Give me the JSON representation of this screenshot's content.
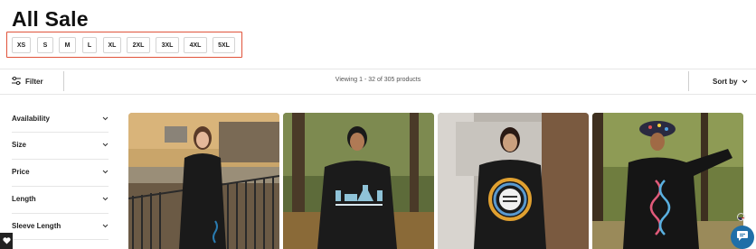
{
  "page": {
    "title": "All Sale"
  },
  "sizes": [
    "XS",
    "S",
    "M",
    "L",
    "XL",
    "2XL",
    "3XL",
    "4XL",
    "5XL"
  ],
  "toolbar": {
    "filter_label": "Filter",
    "viewing_text": "Viewing 1 - 32 of 305 products",
    "sort_label": "Sort by"
  },
  "facets": [
    "Availability",
    "Size",
    "Price",
    "Length",
    "Sleeve Length"
  ],
  "products": [
    {
      "image": "woman in black button-up dress by wooden railing"
    },
    {
      "image": "woman in black lab flasks sweatshirt"
    },
    {
      "image": "woman in black circular rainbow graphic sweatshirt"
    },
    {
      "image": "woman in bucket hat and DNA helix sweatshirt"
    }
  ],
  "icons": {
    "filter": "sliders-icon",
    "sort": "chevron-down-icon",
    "facet": "chevron-down-icon",
    "favorite": "heart-icon",
    "chat": "chat-icon",
    "flag": "us-flag-icon"
  },
  "colors": {
    "highlight": "#e0533a",
    "chat": "#1f6fa8"
  }
}
